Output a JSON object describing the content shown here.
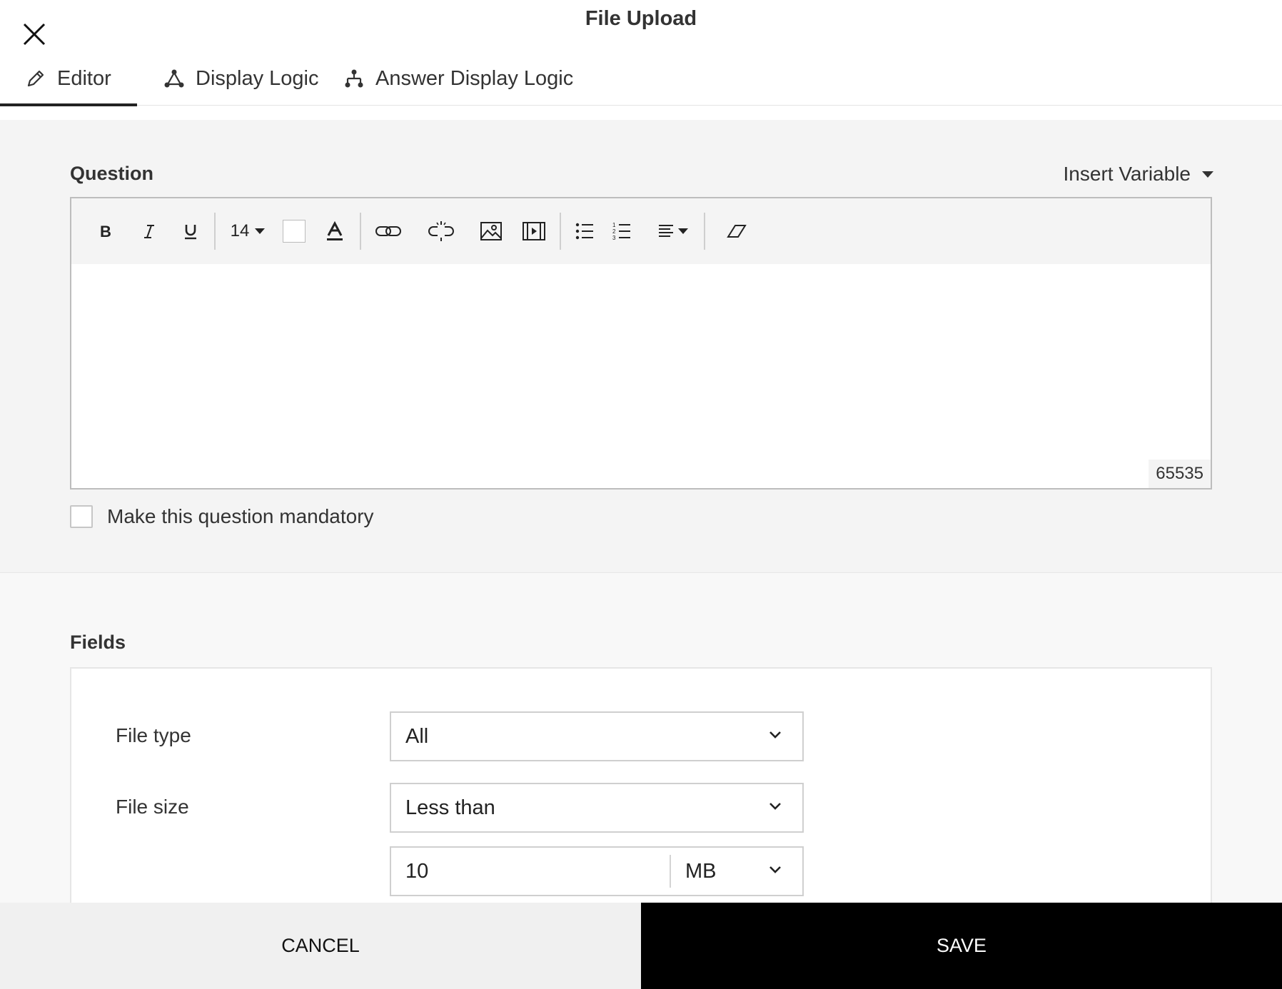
{
  "dialog": {
    "title": "File Upload"
  },
  "tabs": [
    {
      "label": "Editor",
      "icon": "pencil-icon",
      "active": true
    },
    {
      "label": "Display Logic",
      "icon": "display-logic-icon",
      "active": false
    },
    {
      "label": "Answer Display Logic",
      "icon": "answer-logic-icon",
      "active": false
    }
  ],
  "question": {
    "label": "Question",
    "insert_variable_label": "Insert Variable",
    "toolbar": {
      "font_size": "14",
      "buttons": [
        "bold",
        "italic",
        "underline",
        "font-size",
        "background-color",
        "font-color",
        "link",
        "unlink",
        "image",
        "video",
        "bulleted-list",
        "numbered-list",
        "align",
        "clear-formatting"
      ]
    },
    "body_text": "",
    "char_count": "65535",
    "mandatory_label": "Make this question mandatory",
    "mandatory_checked": false
  },
  "fields": {
    "label": "Fields",
    "file_type_label": "File type",
    "file_type_value": "All",
    "file_size_label": "File size",
    "file_size_operator": "Less than",
    "file_size_value": "10",
    "file_size_unit": "MB"
  },
  "footer": {
    "cancel_label": "CANCEL",
    "save_label": "SAVE"
  },
  "colors": {
    "save_bg": "#000000",
    "cancel_bg": "#f0f0f0",
    "section_bg": "#f4f4f4"
  }
}
